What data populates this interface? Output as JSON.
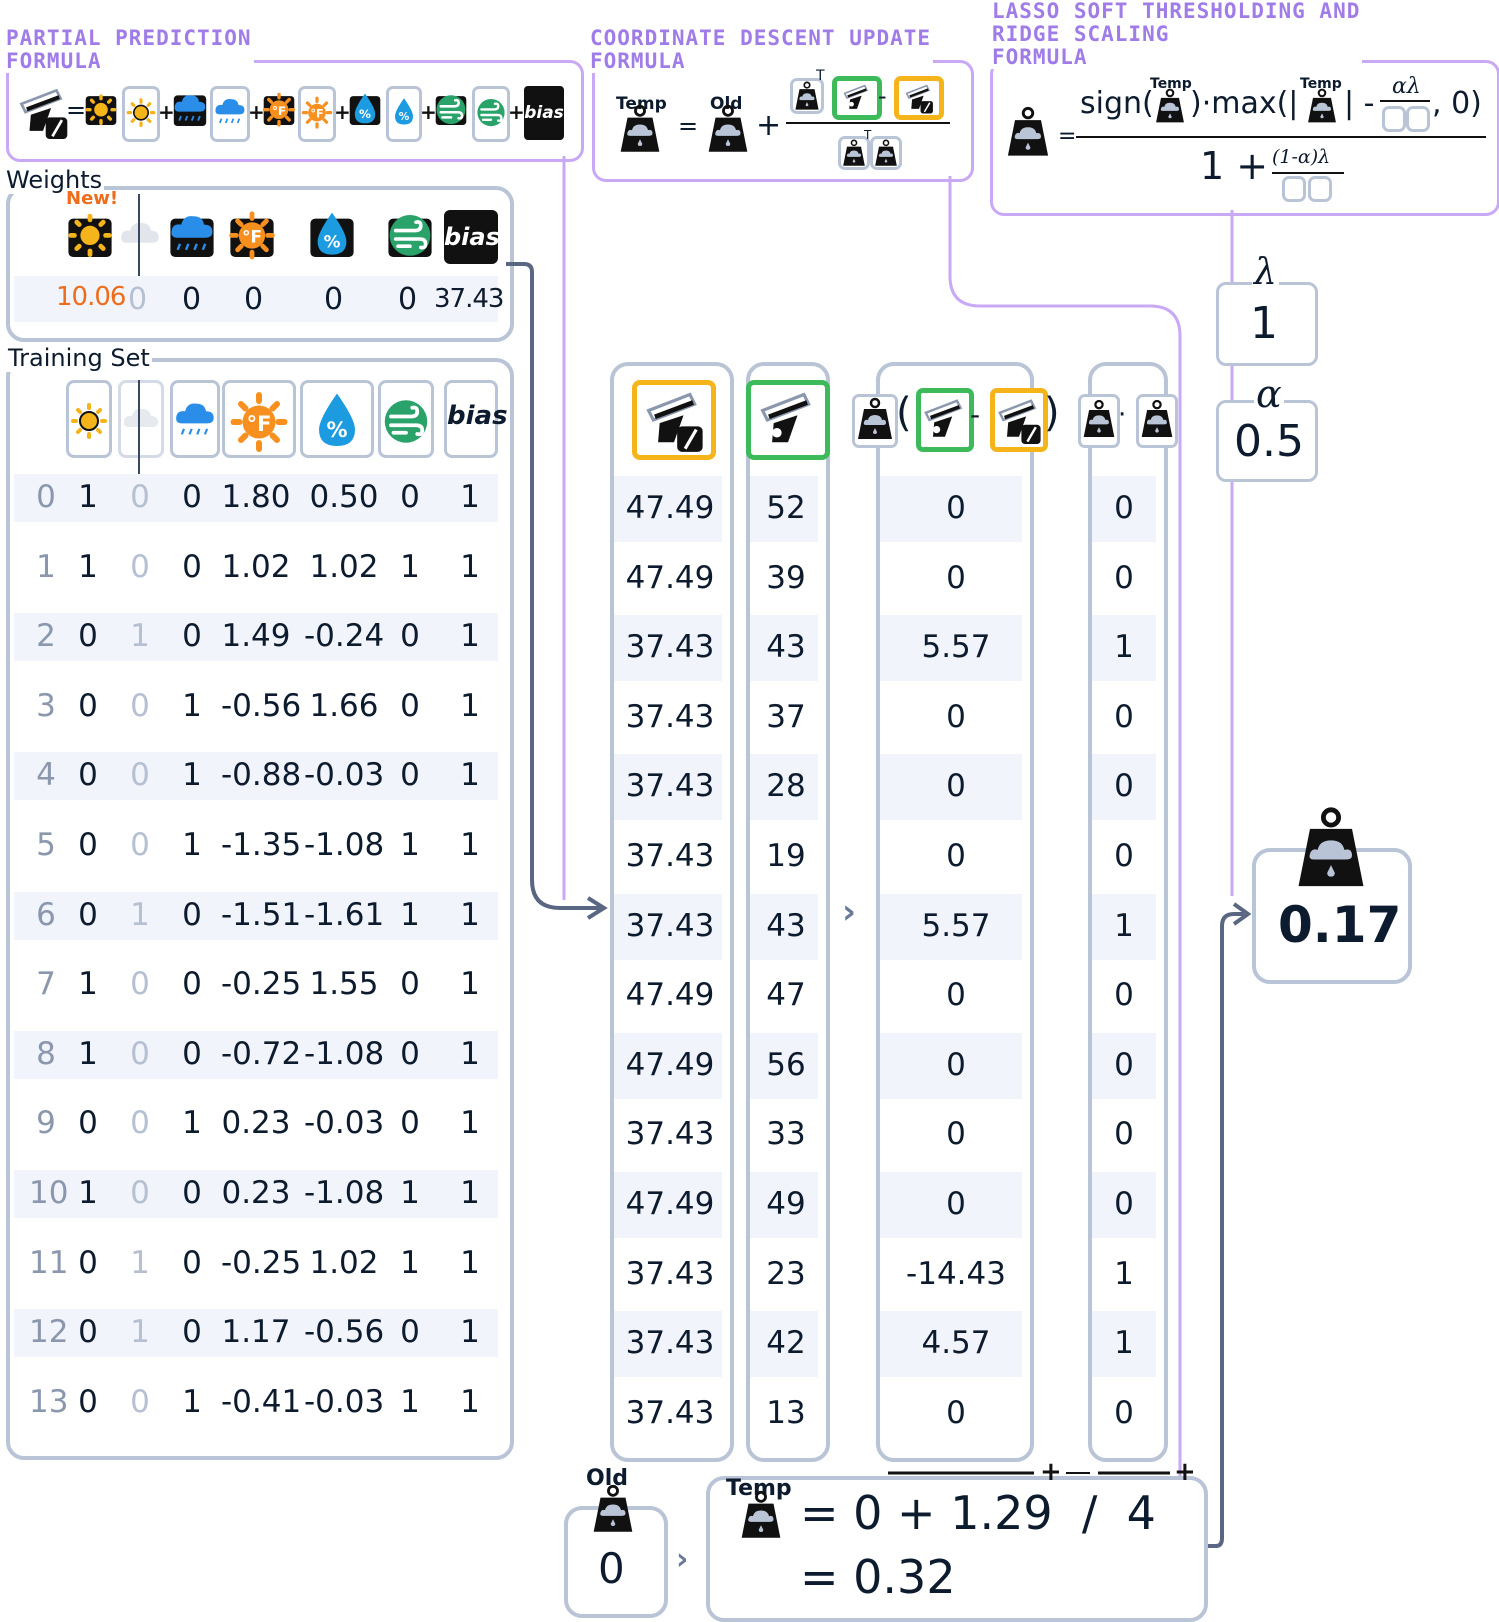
{
  "formulas": {
    "partial_prediction_title": "PARTIAL PREDICTION\nFORMULA",
    "coordinate_descent_title": "COORDINATE DESCENT UPDATE\nFORMULA",
    "lasso_title": "LASSO SOFT THRESHOLDING AND\nRIDGE SCALING\nFORMULA",
    "bias_label": "bias",
    "temp_label": "Temp",
    "old_label": "Old",
    "sign_text": "sign(",
    "max_text": ")·max(|",
    "abs_close": "| -",
    "comma_zero": ", 0)",
    "alpha_lambda": "αλ",
    "one_plus": "1 +",
    "one_minus_alpha_lambda": "(1-α)λ",
    "transpose": "T"
  },
  "weights": {
    "title": "Weights",
    "new_badge": "New!",
    "values": [
      "10.06",
      "0",
      "0",
      "0",
      "0",
      "0",
      "37.43"
    ],
    "bias_label": "bias"
  },
  "training_set": {
    "title": "Training Set",
    "bias_label": "bias",
    "rows": [
      [
        "0",
        "1",
        "0",
        "0",
        "1.80",
        "0.50",
        "0",
        "1"
      ],
      [
        "1",
        "1",
        "0",
        "0",
        "1.02",
        "1.02",
        "1",
        "1"
      ],
      [
        "2",
        "0",
        "1",
        "0",
        "1.49",
        "-0.24",
        "0",
        "1"
      ],
      [
        "3",
        "0",
        "0",
        "1",
        "-0.56",
        "1.66",
        "0",
        "1"
      ],
      [
        "4",
        "0",
        "0",
        "1",
        "-0.88",
        "-0.03",
        "0",
        "1"
      ],
      [
        "5",
        "0",
        "0",
        "1",
        "-1.35",
        "-1.08",
        "1",
        "1"
      ],
      [
        "6",
        "0",
        "1",
        "0",
        "-1.51",
        "-1.61",
        "1",
        "1"
      ],
      [
        "7",
        "1",
        "0",
        "0",
        "-0.25",
        "1.55",
        "0",
        "1"
      ],
      [
        "8",
        "1",
        "0",
        "0",
        "-0.72",
        "-1.08",
        "0",
        "1"
      ],
      [
        "9",
        "0",
        "0",
        "1",
        "0.23",
        "-0.03",
        "0",
        "1"
      ],
      [
        "10",
        "1",
        "0",
        "0",
        "0.23",
        "-1.08",
        "1",
        "1"
      ],
      [
        "11",
        "0",
        "1",
        "0",
        "-0.25",
        "1.02",
        "1",
        "1"
      ],
      [
        "12",
        "0",
        "1",
        "0",
        "1.17",
        "-0.56",
        "0",
        "1"
      ],
      [
        "13",
        "0",
        "0",
        "1",
        "-0.41",
        "-0.03",
        "1",
        "1"
      ]
    ]
  },
  "columns": {
    "partial_prediction": [
      "47.49",
      "47.49",
      "37.43",
      "37.43",
      "37.43",
      "37.43",
      "37.43",
      "47.49",
      "47.49",
      "37.43",
      "47.49",
      "37.43",
      "37.43",
      "37.43"
    ],
    "target": [
      "52",
      "39",
      "43",
      "37",
      "28",
      "19",
      "43",
      "47",
      "56",
      "33",
      "49",
      "23",
      "42",
      "13"
    ],
    "residual_product": [
      "0",
      "0",
      "5.57",
      "0",
      "0",
      "0",
      "5.57",
      "0",
      "0",
      "0",
      "0",
      "-14.43",
      "4.57",
      "0"
    ],
    "feature_squared": [
      "0",
      "0",
      "1",
      "0",
      "0",
      "0",
      "1",
      "0",
      "0",
      "0",
      "0",
      "1",
      "1",
      "0"
    ]
  },
  "params": {
    "lambda_symbol": "λ",
    "lambda_value": "1",
    "alpha_symbol": "α",
    "alpha_value": "0.5"
  },
  "result": {
    "new_weight": "0.17",
    "old_label": "Old",
    "old_value": "0",
    "temp_label": "Temp",
    "temp_line1": "= 0 + 1.29  /  4",
    "temp_line2": "= 0.32",
    "plus_sign": "+"
  }
}
